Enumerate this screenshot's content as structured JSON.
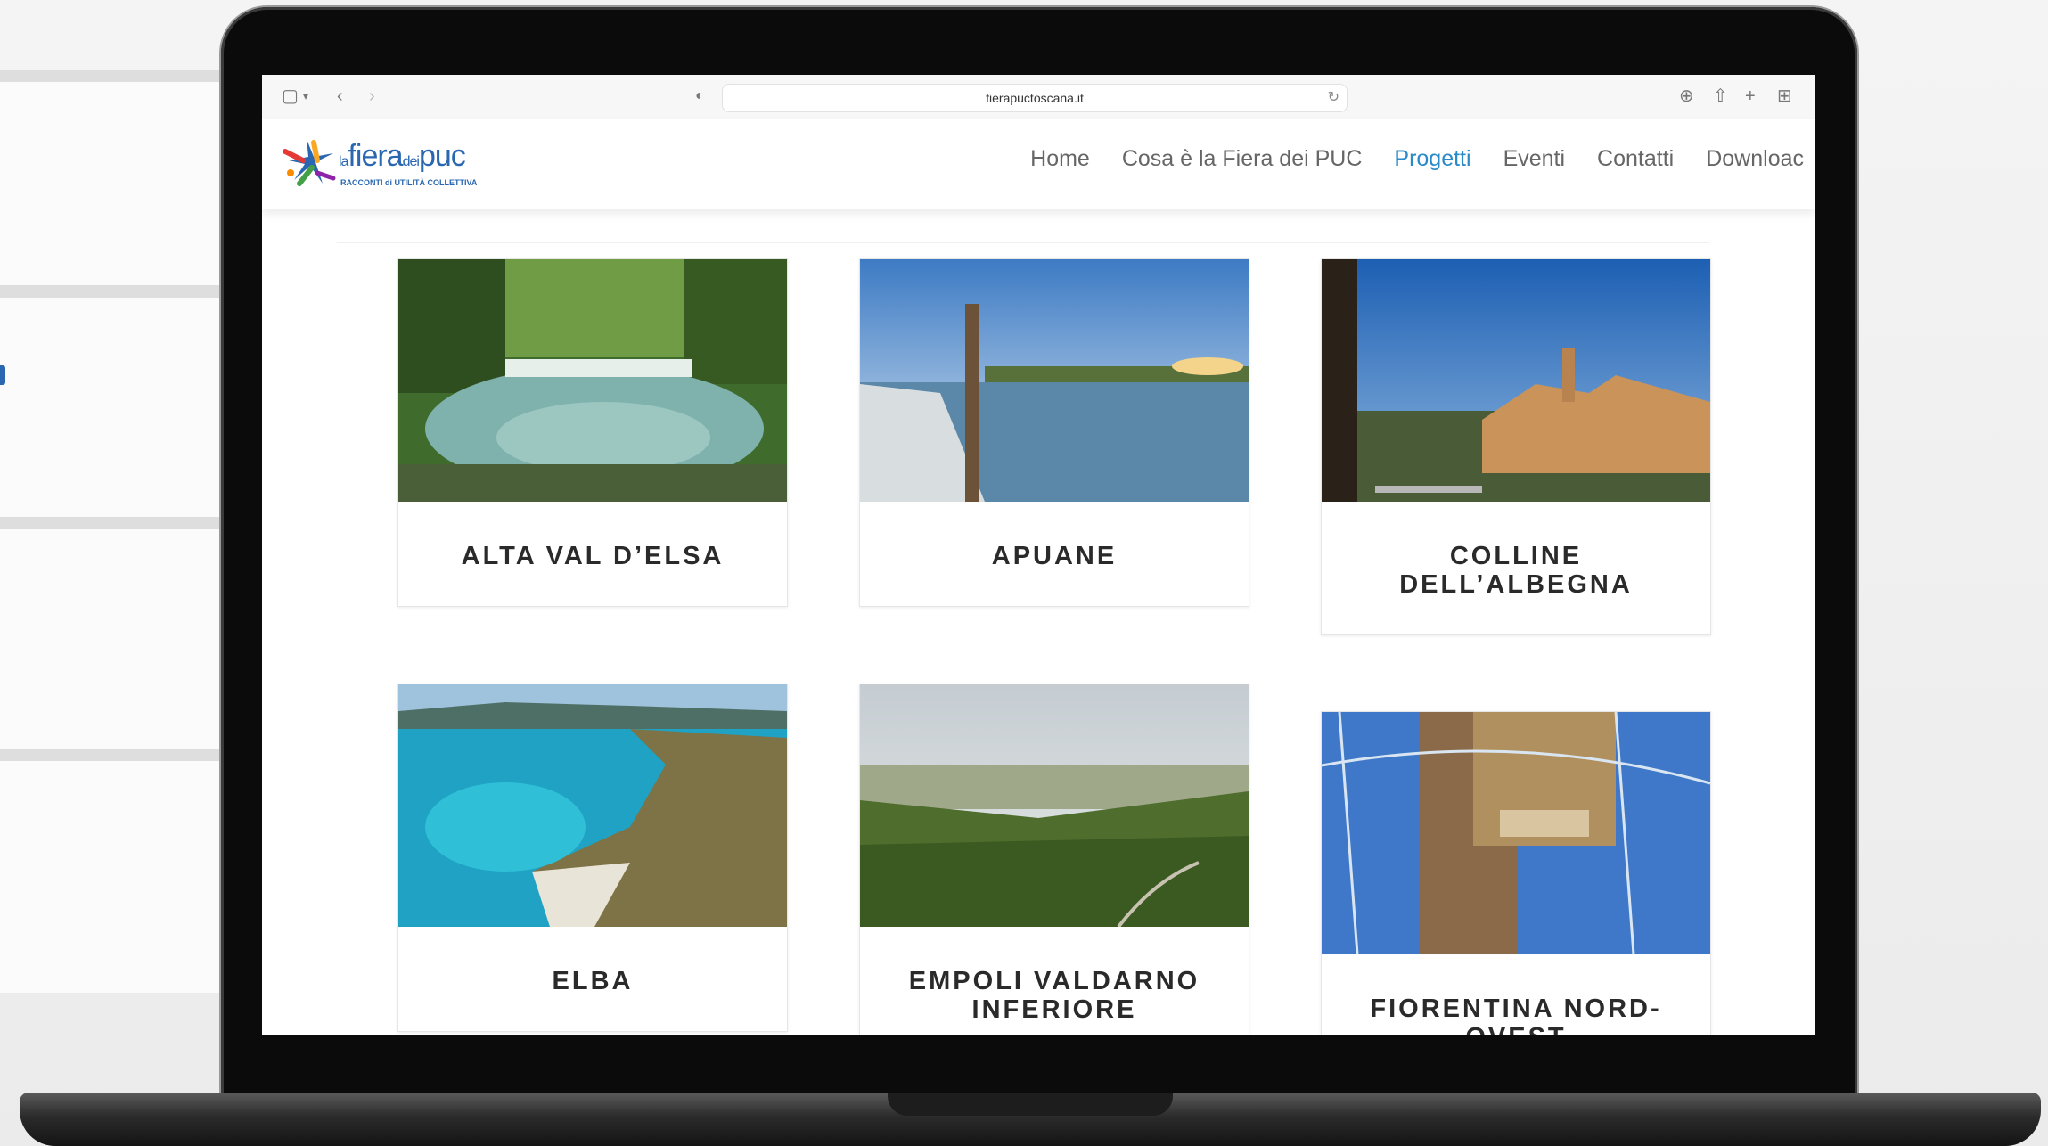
{
  "browser": {
    "url": "fierapuctoscana.it"
  },
  "site": {
    "logo_main": "fiera",
    "logo_prefix": "la",
    "logo_dei": "dei",
    "logo_puc": "puc",
    "logo_tagline": "RACCONTI di UTILITÀ COLLETTIVA",
    "nav": [
      {
        "label": "Home",
        "active": false
      },
      {
        "label": "Cosa è la Fiera dei PUC",
        "active": false
      },
      {
        "label": "Progetti",
        "active": true
      },
      {
        "label": "Eventi",
        "active": false
      },
      {
        "label": "Contatti",
        "active": false
      },
      {
        "label": "Downloac",
        "active": false
      }
    ]
  },
  "projects": [
    {
      "title": "ALTA VAL D’ELSA",
      "image": "waterfall-forest"
    },
    {
      "title": "APUANE",
      "image": "river-sunset"
    },
    {
      "title": "COLLINE DELL’ALBEGNA",
      "image": "hilltop-town"
    },
    {
      "title": "ELBA",
      "image": "coast-aerial"
    },
    {
      "title": "EMPOLI VALDARNO INFERIORE",
      "image": "green-hills"
    },
    {
      "title": "FIORENTINA NORD-OVEST",
      "image": "reflection-tower"
    }
  ],
  "colors": {
    "accent": "#2a8ac9",
    "brand": "#2a67b0",
    "title_text": "#2a2a2a",
    "nav_text": "#666666"
  }
}
